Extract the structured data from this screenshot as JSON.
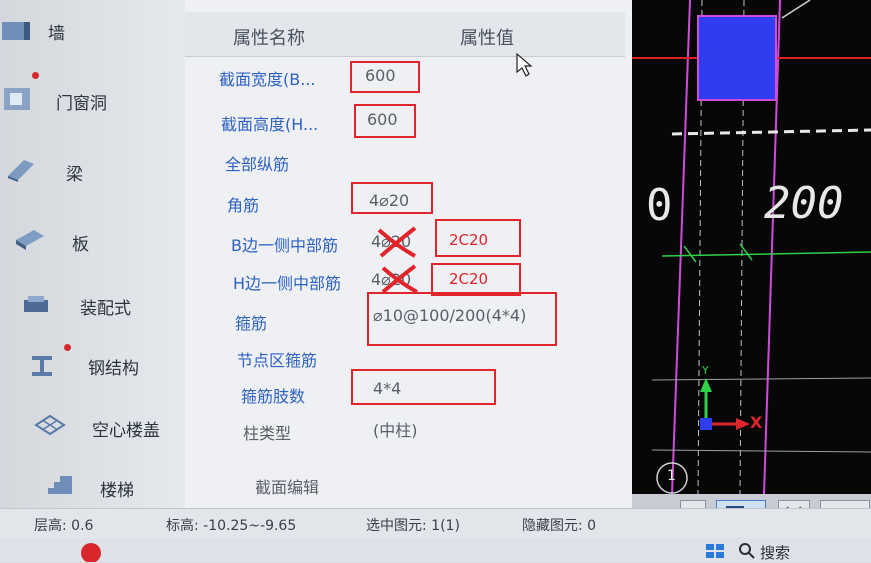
{
  "sidebar": {
    "items": [
      {
        "label": "墙",
        "dot": false
      },
      {
        "label": "门窗洞",
        "dot": true
      },
      {
        "label": "梁",
        "dot": false
      },
      {
        "label": "板",
        "dot": false
      },
      {
        "label": "装配式",
        "dot": false
      },
      {
        "label": "钢结构",
        "dot": true
      },
      {
        "label": "空心楼盖",
        "dot": false
      },
      {
        "label": "楼梯",
        "dot": false
      }
    ]
  },
  "properties": {
    "header": {
      "name": "属性名称",
      "value": "属性值"
    },
    "rows": [
      {
        "name": "截面宽度(B...",
        "value": "600"
      },
      {
        "name": "截面高度(H...",
        "value": "600"
      },
      {
        "name": "全部纵筋",
        "value": ""
      },
      {
        "name": "角筋",
        "value": "4⌀20"
      },
      {
        "name": "B边一侧中部筋",
        "value": "4⌀20"
      },
      {
        "name": "H边一侧中部筋",
        "value": "4⌀20"
      },
      {
        "name": "箍筋",
        "value": "⌀10@100/200(4*4)"
      },
      {
        "name": "节点区箍筋",
        "value": ""
      },
      {
        "name": "箍筋肢数",
        "value": "4*4"
      },
      {
        "name": "柱类型",
        "value": "(中柱)"
      }
    ],
    "footer": "截面编辑"
  },
  "annotations": {
    "b_side": "2C20",
    "h_side": "2C20"
  },
  "cad": {
    "dimension": "200",
    "dimension_left": "0",
    "axis_x": "X",
    "axis_y": "Y",
    "corner_label": "1"
  },
  "status": {
    "floor_height": "层高:  0.6",
    "elevation": "标高:  -10.25~-9.65",
    "selected": "选中图元:  1(1)",
    "hidden": "隐藏图元:  0"
  },
  "taskbar": {
    "search": "搜索"
  },
  "colors": {
    "annotation": "#e0242b",
    "link_blue": "#2f62c2",
    "cad_column": "#2f3cf0",
    "cad_magenta": "#d04bd8",
    "cad_green": "#2fd04a"
  }
}
